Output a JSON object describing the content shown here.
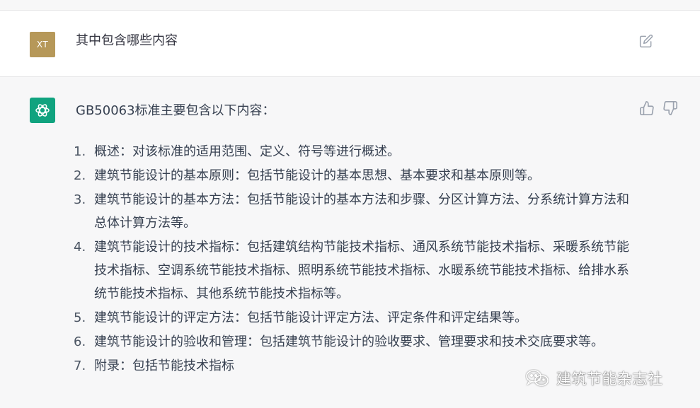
{
  "user_message": {
    "avatar_initials": "XT",
    "text": "其中包含哪些内容",
    "avatar_color": "#b69859"
  },
  "assistant_message": {
    "avatar_color": "#10a37f",
    "intro": "GB50063标准主要包含以下内容：",
    "items": [
      {
        "num": "1.",
        "text": "概述：对该标准的适用范围、定义、符号等进行概述。"
      },
      {
        "num": "2.",
        "text": "建筑节能设计的基本原则：包括节能设计的基本思想、基本要求和基本原则等。"
      },
      {
        "num": "3.",
        "text": "建筑节能设计的基本方法：包括节能设计的基本方法和步骤、分区计算方法、分系统计算方法和总体计算方法等。"
      },
      {
        "num": "4.",
        "text": "建筑节能设计的技术指标：包括建筑结构节能技术指标、通风系统节能技术指标、采暖系统节能技术指标、空调系统节能技术指标、照明系统节能技术指标、水暖系统节能技术指标、给排水系统节能技术指标、其他系统节能技术指标等。"
      },
      {
        "num": "5.",
        "text": "建筑节能设计的评定方法：包括节能设计评定方法、评定条件和评定结果等。"
      },
      {
        "num": "6.",
        "text": "建筑节能设计的验收和管理：包括建筑节能设计的验收要求、管理要求和技术交底要求等。"
      },
      {
        "num": "7.",
        "text": "附录：包括节能技术指标"
      }
    ]
  },
  "watermark": {
    "text": "建筑节能杂志社",
    "icon": "wechat-icon"
  },
  "icons": {
    "edit": "edit-icon",
    "thumbs_up": "thumbs-up-icon",
    "thumbs_down": "thumbs-down-icon",
    "assistant_logo": "openai-logo-icon"
  }
}
